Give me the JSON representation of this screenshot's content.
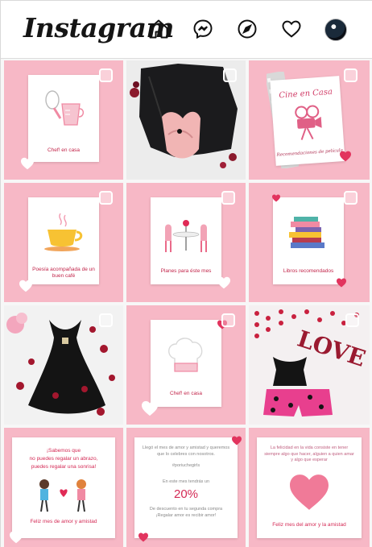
{
  "app": {
    "logo": "Instagram"
  },
  "nav": {
    "home_icon": "home-icon",
    "messenger_icon": "messenger-icon",
    "explore_icon": "compass-icon",
    "activity_icon": "heart-icon",
    "avatar_icon": "profile-avatar"
  },
  "colors": {
    "tile_pink": "#f7b8c6",
    "accent": "#d42a55",
    "text_pink": "#c2254a"
  },
  "posts": {
    "chef1": {
      "label": "Chef! en casa"
    },
    "cine": {
      "title": "Cine en Casa",
      "subtitle": "Recomendaciones de película"
    },
    "poesia": {
      "label": "Poesía acompañada de un buen café"
    },
    "planes": {
      "label": "Planes para éste mes"
    },
    "libros": {
      "label": "Libros recomendados"
    },
    "chef2": {
      "label": "Chef! en casa"
    },
    "abrazo": {
      "line1": "¡Sabemos que",
      "line2": "no puedes regalar un abrazo,",
      "line3": "puedes regalar una sonrisa!",
      "footer": "Feliz mes de amor y amistad"
    },
    "promo": {
      "intro": "Llegó el mes de amor y amistad y queremos que lo celebres con nosotros.",
      "hashtag": "#poriuchegirls",
      "line": "En este mes tendrás un",
      "percent": "20%",
      "desc": "De descuento en tu segunda compra ¡Regalar amor es recibir amor!"
    },
    "felicidad": {
      "quote": "La felicidad en la vida consiste en tener siempre algo que hacer, alguien a quien amar y algo que esperar",
      "footer": "Feliz mes del amor y la amistad"
    }
  }
}
